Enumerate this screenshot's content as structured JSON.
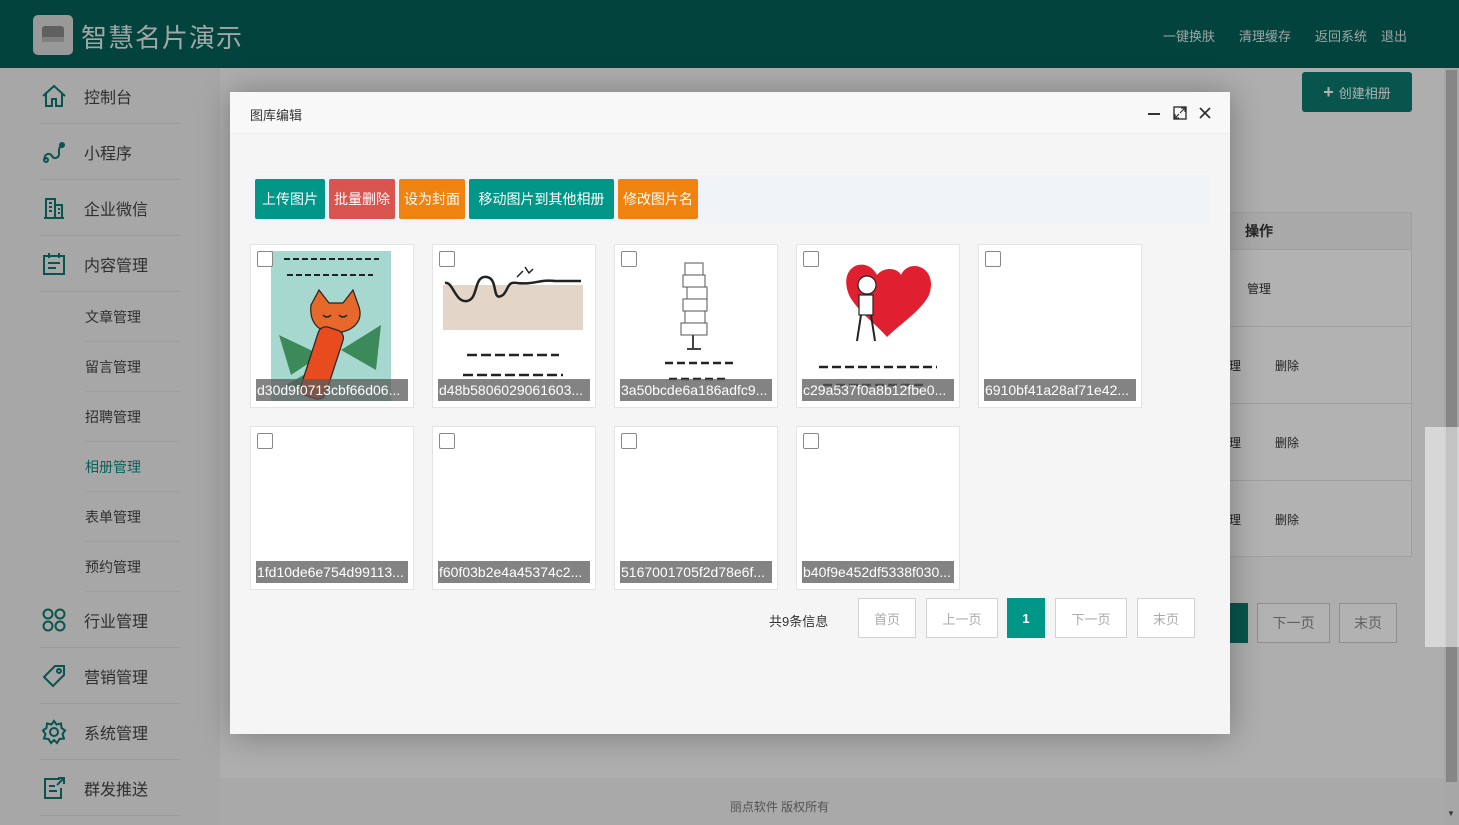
{
  "header": {
    "title": "智慧名片演示",
    "links": [
      "一键换肤",
      "清理缓存",
      "返回系统",
      "退出"
    ]
  },
  "sidebar": {
    "items": [
      {
        "label": "控制台",
        "icon": "home-icon"
      },
      {
        "label": "小程序",
        "icon": "miniapp-icon"
      },
      {
        "label": "企业微信",
        "icon": "building-icon"
      },
      {
        "label": "内容管理",
        "icon": "clipboard-icon"
      }
    ],
    "sub_items": [
      "文章管理",
      "留言管理",
      "招聘管理",
      "相册管理",
      "表单管理",
      "预约管理"
    ],
    "lower_items": [
      {
        "label": "行业管理",
        "icon": "grid-icon"
      },
      {
        "label": "营销管理",
        "icon": "tag-icon"
      },
      {
        "label": "系统管理",
        "icon": "gear-icon"
      },
      {
        "label": "群发推送",
        "icon": "send-icon"
      }
    ]
  },
  "background": {
    "create_label": "创建相册",
    "table_header": "操作",
    "row_manage": "管理",
    "row_manage_cut": "理",
    "row_delete": "删除",
    "pager_next": "下一页",
    "pager_last": "末页",
    "footer": "丽点软件 版权所有"
  },
  "dialog": {
    "title": "图库编辑",
    "toolbar": {
      "upload": "上传图片",
      "batch_delete": "批量删除",
      "set_cover": "设为封面",
      "move": "移动图片到其他相册",
      "rename": "修改图片名"
    },
    "images": [
      {
        "name": "d30d9f0713cbf66d06..."
      },
      {
        "name": "d48b5806029061603..."
      },
      {
        "name": "3a50bcde6a186adfc9..."
      },
      {
        "name": "c29a537f0a8b12fbe0..."
      },
      {
        "name": "6910bf41a28af71e42..."
      },
      {
        "name": "1fd10de6e754d99113..."
      },
      {
        "name": "f60f03b2e4a45374c2..."
      },
      {
        "name": "5167001705f2d78e6f..."
      },
      {
        "name": "b40f9e452df5338f030..."
      }
    ],
    "pager": {
      "total": "共9条信息",
      "first": "首页",
      "prev": "上一页",
      "current": "1",
      "next": "下一页",
      "last": "末页"
    }
  },
  "colors": {
    "header": "#05605a",
    "accent": "#009688",
    "danger": "#d9534f",
    "warning": "#f0820f"
  }
}
